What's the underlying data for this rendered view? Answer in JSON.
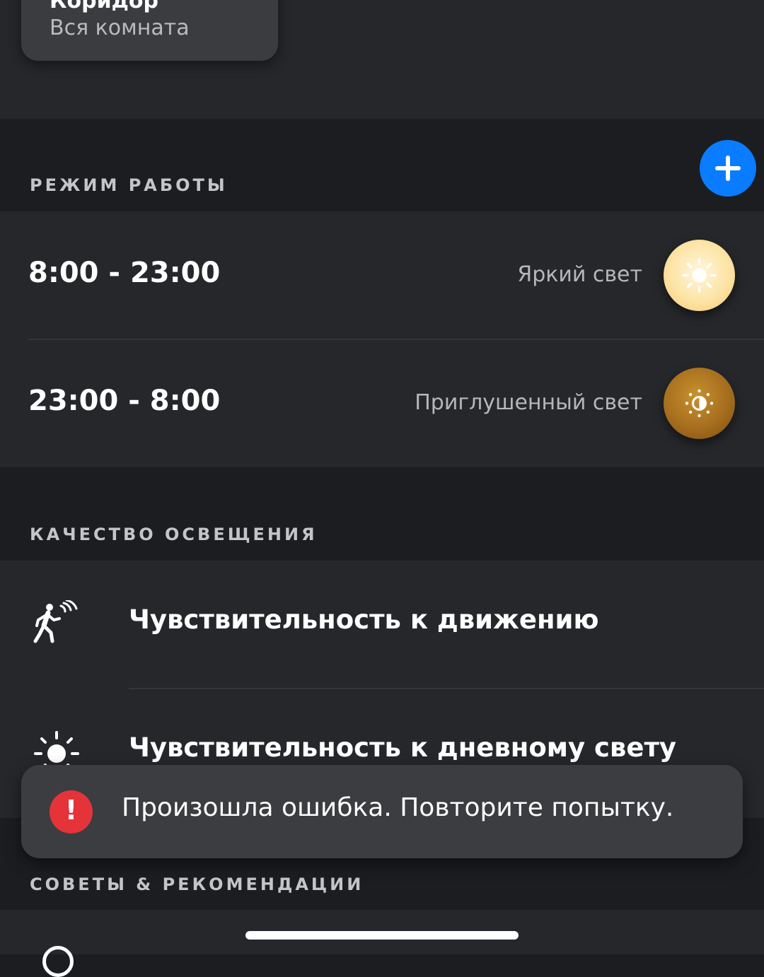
{
  "room": {
    "name": "Коридор",
    "subtitle": "Вся комната"
  },
  "work_mode": {
    "title": "РЕЖИМ РАБОТЫ",
    "add_icon": "plus-icon",
    "schedules": [
      {
        "time": "8:00 - 23:00",
        "scene": "Яркий свет",
        "icon": "bright-sun-icon"
      },
      {
        "time": "23:00 - 8:00",
        "scene": "Приглушенный свет",
        "icon": "dimmed-sun-icon"
      }
    ]
  },
  "lighting_quality": {
    "title": "КАЧЕСТВО ОСВЕЩЕНИЯ",
    "items": [
      {
        "label": "Чувствительность к движению",
        "icon": "motion-sensor-icon"
      },
      {
        "label": "Чувствительность к дневному свету",
        "icon": "daylight-icon"
      }
    ]
  },
  "tips": {
    "title": "СОВЕТЫ & РЕКОМЕНДАЦИИ"
  },
  "toast": {
    "message": "Произошла ошибка. Повторите попытку.",
    "icon": "error-icon"
  },
  "colors": {
    "accent": "#0a7cff",
    "error": "#e5333a",
    "background": "#1b1d20",
    "panel": "#25272b"
  }
}
